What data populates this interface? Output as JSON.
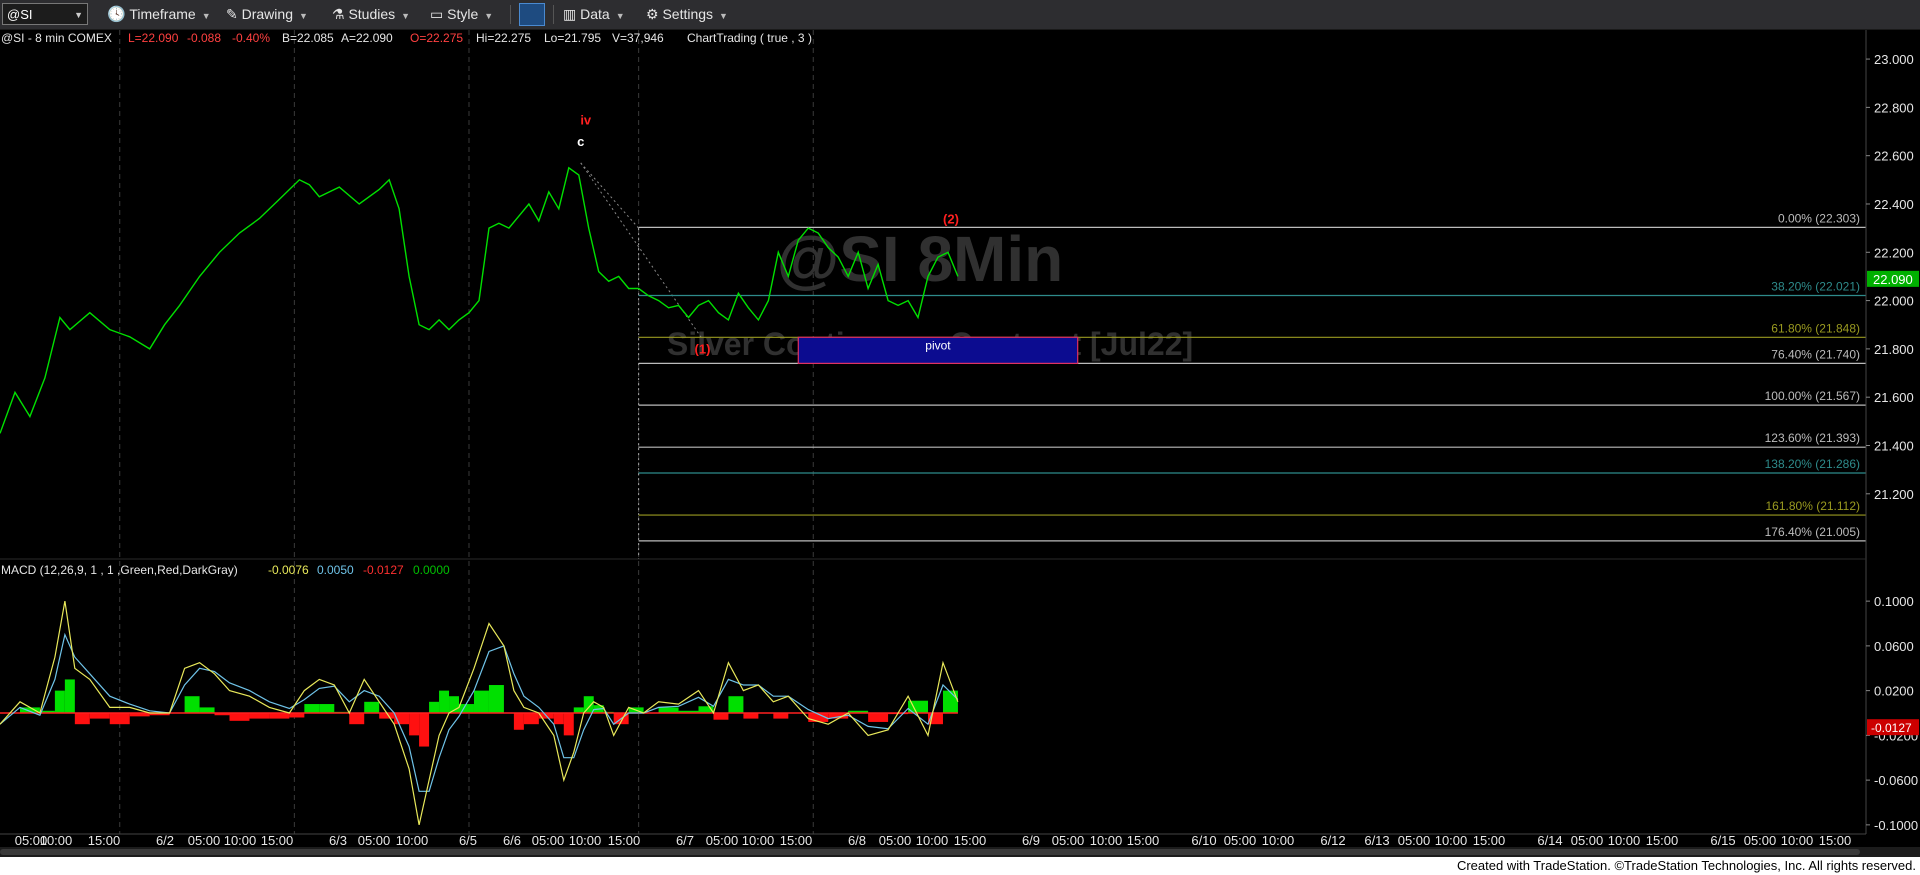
{
  "toolbar": {
    "symbol": "@SI",
    "timeframe": "Timeframe",
    "drawing": "Drawing",
    "studies": "Studies",
    "style": "Style",
    "data": "Data",
    "settings": "Settings"
  },
  "chart_data": {
    "type": "line",
    "header": {
      "symbol": "@SI - 8 min  COMEX",
      "last": "L=22.090",
      "change": "-0.088",
      "change_pct": "-0.40%",
      "bid": "B=22.085",
      "ask": "A=22.090",
      "open": "O=22.275",
      "high": "Hi=22.275",
      "low": "Lo=21.795",
      "volume": "V=37,946",
      "study": "ChartTrading ( true , 3 )"
    },
    "watermark": {
      "title": "@SI 8Min",
      "subtitle": "Silver Continuous Contract [Jul22]"
    },
    "price_axis": {
      "ylim": [
        20.93,
        23.05
      ],
      "ticks": [
        "23.000",
        "22.800",
        "22.600",
        "22.400",
        "22.200",
        "22.000",
        "21.800",
        "21.600",
        "21.400",
        "21.200"
      ],
      "tick_values": [
        23.0,
        22.8,
        22.6,
        22.4,
        22.2,
        22.0,
        21.8,
        21.6,
        21.4,
        21.2
      ],
      "last_price_tag": "22.090",
      "last_price": 22.09
    },
    "x_range": [
      0,
      1870
    ],
    "price_series": {
      "name": "@SI 8 min",
      "color": "#00e000",
      "x": [
        0,
        15,
        30,
        45,
        60,
        70,
        90,
        110,
        130,
        150,
        165,
        180,
        200,
        220,
        240,
        260,
        280,
        300,
        310,
        320,
        340,
        360,
        380,
        390,
        400,
        410,
        420,
        430,
        440,
        450,
        460,
        470,
        480,
        490,
        500,
        510,
        520,
        530,
        540,
        550,
        560,
        570,
        580,
        590,
        600,
        610,
        620,
        630,
        640,
        650,
        660,
        670,
        680,
        690,
        700,
        710,
        720,
        730,
        740,
        750,
        760,
        770,
        780,
        790,
        800,
        810,
        820,
        830,
        840,
        850,
        860,
        870,
        880,
        890,
        900,
        910,
        920,
        930,
        940,
        950,
        960
      ],
      "y": [
        21.45,
        21.62,
        21.52,
        21.68,
        21.93,
        21.88,
        21.95,
        21.88,
        21.85,
        21.8,
        21.9,
        21.98,
        22.1,
        22.2,
        22.28,
        22.34,
        22.42,
        22.5,
        22.48,
        22.43,
        22.47,
        22.4,
        22.46,
        22.5,
        22.38,
        22.1,
        21.9,
        21.88,
        21.92,
        21.88,
        21.92,
        21.95,
        22.0,
        22.3,
        22.32,
        22.3,
        22.35,
        22.4,
        22.33,
        22.45,
        22.38,
        22.55,
        22.52,
        22.3,
        22.12,
        22.08,
        22.1,
        22.05,
        22.05,
        22.02,
        22.0,
        21.97,
        21.98,
        21.93,
        21.98,
        22.0,
        21.95,
        21.92,
        22.03,
        21.97,
        21.92,
        22.0,
        22.2,
        22.1,
        22.25,
        22.3,
        22.28,
        22.22,
        22.18,
        22.1,
        22.2,
        22.05,
        22.15,
        22.0,
        21.98,
        22.0,
        21.93,
        22.1,
        22.18,
        22.2,
        22.1
      ]
    },
    "dates": [
      "05:00",
      "10:00",
      "15:00",
      "6/2",
      "05:00",
      "10:00",
      "15:00",
      "6/3",
      "05:00",
      "10:00",
      "6/5",
      "6/6",
      "05:00",
      "10:00",
      "15:00",
      "6/7",
      "05:00",
      "10:00",
      "15:00",
      "6/8",
      "05:00",
      "10:00",
      "15:00",
      "6/9",
      "05:00",
      "10:00",
      "15:00",
      "6/10",
      "05:00",
      "10:00",
      "6/12",
      "6/13",
      "05:00",
      "10:00",
      "15:00",
      "6/14",
      "05:00",
      "10:00",
      "15:00",
      "6/15",
      "05:00",
      "10:00",
      "15:00"
    ],
    "date_x": [
      31,
      56,
      104,
      165,
      204,
      240,
      277,
      338,
      374,
      412,
      468,
      512,
      548,
      585,
      624,
      685,
      722,
      758,
      796,
      857,
      895,
      932,
      970,
      1031,
      1068,
      1106,
      1143,
      1204,
      1240,
      1278,
      1333,
      1377,
      1414,
      1451,
      1489,
      1550,
      1587,
      1624,
      1662,
      1723,
      1760,
      1797,
      1835
    ],
    "session_lines_x": [
      120,
      295,
      470,
      640,
      815
    ],
    "wave_labels": [
      {
        "text": "iv",
        "x": 587,
        "y": 22.73,
        "color": "#ff2020"
      },
      {
        "text": "c",
        "x": 582,
        "y": 22.64,
        "color": "#ffffff"
      },
      {
        "text": "(1)",
        "x": 704,
        "y": 21.78,
        "color": "#ff2020"
      },
      {
        "text": "(2)",
        "x": 953,
        "y": 22.32,
        "color": "#ff2020"
      }
    ],
    "fib_levels": [
      {
        "label": "0.00% (22.303)",
        "value": 22.303,
        "color": "#bbbbbb"
      },
      {
        "label": "38.20% (22.021)",
        "value": 22.021,
        "color": "#2e8b8b"
      },
      {
        "label": "61.80% (21.848)",
        "value": 21.848,
        "color": "#9a9a20"
      },
      {
        "label": "76.40% (21.740)",
        "value": 21.74,
        "color": "#bbbbbb"
      },
      {
        "label": "100.00% (21.567)",
        "value": 21.567,
        "color": "#bbbbbb"
      },
      {
        "label": "123.60% (21.393)",
        "value": 21.393,
        "color": "#bbbbbb"
      },
      {
        "label": "138.20% (21.286)",
        "value": 21.286,
        "color": "#2e8b8b"
      },
      {
        "label": "161.80% (21.112)",
        "value": 21.112,
        "color": "#9a9a20"
      },
      {
        "label": "176.40% (21.005)",
        "value": 21.005,
        "color": "#bbbbbb"
      }
    ],
    "pivot_box": {
      "label": "pivot",
      "x0": 800,
      "x1": 1080,
      "top": 21.848,
      "bottom": 21.74,
      "fill": "#0c0c90",
      "border": "#e03060"
    },
    "macd": {
      "header": "MACD (12,26,9, 1 , 1 ,Green,Red,DarkGray)",
      "values": [
        "-0.0076",
        "0.0050",
        "-0.0127",
        "0.0000"
      ],
      "value_colors": [
        "#e8e85a",
        "#6fc3e8",
        "#ff3030",
        "#00c000"
      ],
      "ylim": [
        -0.118,
        0.118
      ],
      "ticks": [
        "0.1000",
        "0.0600",
        "0.0200",
        "-0.0200",
        "-0.0600",
        "-0.1000"
      ],
      "tick_values": [
        0.1,
        0.06,
        0.02,
        -0.02,
        -0.06,
        -0.1
      ],
      "last_tag": "-0.0127",
      "last_value": -0.0127,
      "x": [
        0,
        20,
        40,
        55,
        65,
        75,
        90,
        110,
        130,
        150,
        170,
        185,
        200,
        215,
        230,
        250,
        270,
        290,
        305,
        320,
        335,
        350,
        365,
        380,
        395,
        410,
        420,
        430,
        440,
        450,
        460,
        475,
        490,
        505,
        515,
        525,
        540,
        555,
        565,
        575,
        585,
        595,
        605,
        615,
        630,
        645,
        660,
        680,
        700,
        715,
        730,
        745,
        760,
        775,
        790,
        810,
        830,
        850,
        870,
        890,
        910,
        930,
        945,
        960
      ],
      "macd_line": [
        -0.01,
        0.01,
        0.0,
        0.05,
        0.1,
        0.04,
        0.03,
        0.005,
        0.005,
        0.0,
        0.0,
        0.04,
        0.045,
        0.035,
        0.02,
        0.015,
        0.005,
        0.0,
        0.02,
        0.03,
        0.025,
        0.0,
        0.03,
        0.01,
        -0.01,
        -0.05,
        -0.1,
        -0.06,
        -0.02,
        0.0,
        0.005,
        0.04,
        0.08,
        0.06,
        0.02,
        0.005,
        0.0,
        -0.02,
        -0.06,
        -0.035,
        0.0,
        0.01,
        0.005,
        -0.02,
        0.005,
        0.0,
        0.01,
        0.008,
        0.02,
        0.0,
        0.045,
        0.02,
        0.025,
        0.01,
        0.015,
        -0.005,
        -0.01,
        0.0,
        -0.02,
        -0.015,
        0.015,
        -0.02,
        0.045,
        0.01
      ],
      "signal_line": [
        -0.01,
        0.005,
        -0.002,
        0.03,
        0.07,
        0.05,
        0.035,
        0.015,
        0.008,
        0.002,
        0.0,
        0.025,
        0.04,
        0.037,
        0.027,
        0.02,
        0.01,
        0.004,
        0.012,
        0.022,
        0.024,
        0.01,
        0.02,
        0.015,
        0.0,
        -0.03,
        -0.07,
        -0.07,
        -0.04,
        -0.015,
        -0.003,
        0.02,
        0.055,
        0.06,
        0.035,
        0.015,
        0.005,
        -0.01,
        -0.04,
        -0.04,
        -0.015,
        0.003,
        0.004,
        -0.01,
        0.0,
        0.0,
        0.005,
        0.006,
        0.014,
        0.006,
        0.03,
        0.025,
        0.025,
        0.015,
        0.015,
        0.003,
        -0.005,
        -0.002,
        -0.012,
        -0.014,
        0.004,
        -0.01,
        0.025,
        0.012
      ]
    }
  },
  "footer": "Created with TradeStation. ©TradeStation Technologies, Inc. All rights reserved."
}
